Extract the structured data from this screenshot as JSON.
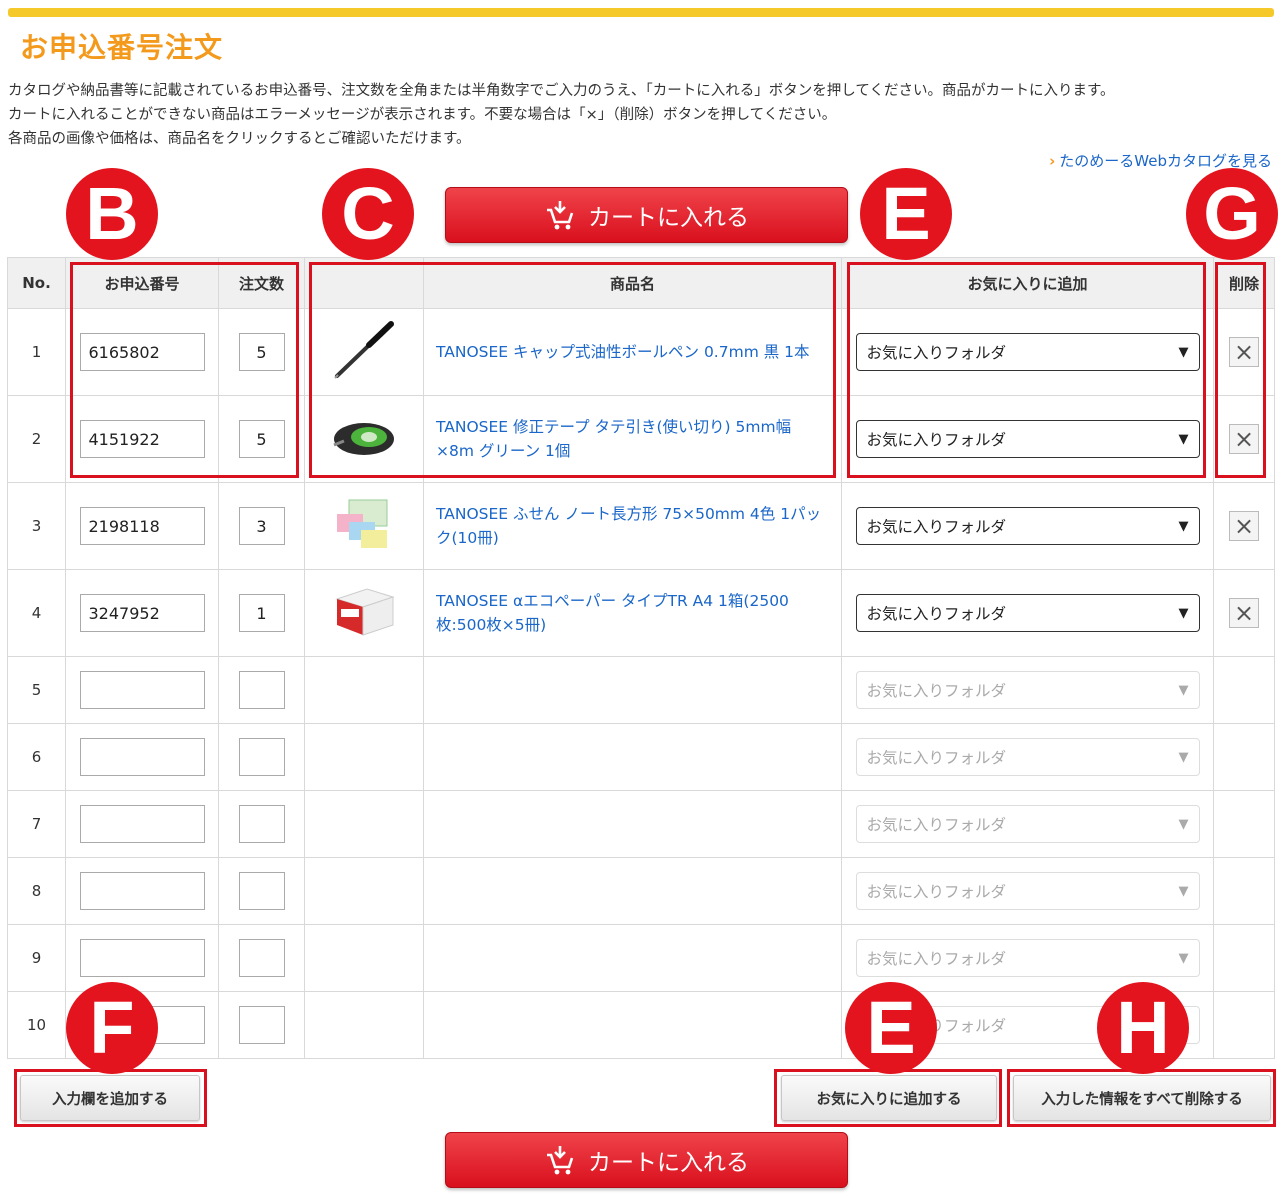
{
  "page": {
    "title": "お申込番号注文",
    "intro_lines": [
      "カタログや納品書等に記載されているお申込番号、注文数を全角または半角数字でご入力のうえ、「カートに入れる」ボタンを押してください。商品がカートに入ります。",
      "カートに入れることができない商品はエラーメッセージが表示されます。不要な場合は「×」（削除）ボタンを押してください。",
      "各商品の画像や価格は、商品名をクリックするとご確認いただけます。"
    ],
    "catalog_link": "たのめーるWebカタログを見る"
  },
  "cart_button_label": "カートに入れる",
  "table": {
    "headers": {
      "no": "No.",
      "code": "お申込番号",
      "qty": "注文数",
      "image": "",
      "name": "商品名",
      "favorite": "お気に入りに追加",
      "delete": "削除"
    },
    "rows": [
      {
        "no": "1",
        "code": "6165802",
        "qty": "5",
        "name": "TANOSEE キャップ式油性ボールペン 0.7mm 黒 1本",
        "favorite": "お気に入りフォルダ"
      },
      {
        "no": "2",
        "code": "4151922",
        "qty": "5",
        "name": "TANOSEE 修正テープ タテ引き(使い切り) 5mm幅×8m グリーン 1個",
        "favorite": "お気に入りフォルダ"
      },
      {
        "no": "3",
        "code": "2198118",
        "qty": "3",
        "name": "TANOSEE ふせん ノート長方形 75×50mm 4色 1パック(10冊)",
        "favorite": "お気に入りフォルダ"
      },
      {
        "no": "4",
        "code": "3247952",
        "qty": "1",
        "name": "TANOSEE αエコペーパー タイプTR A4 1箱(2500枚:500枚×5冊)",
        "favorite": "お気に入りフォルダ"
      },
      {
        "no": "5",
        "code": "",
        "qty": "",
        "name": "",
        "favorite": "お気に入りフォルダ"
      },
      {
        "no": "6",
        "code": "",
        "qty": "",
        "name": "",
        "favorite": "お気に入りフォルダ"
      },
      {
        "no": "7",
        "code": "",
        "qty": "",
        "name": "",
        "favorite": "お気に入りフォルダ"
      },
      {
        "no": "8",
        "code": "",
        "qty": "",
        "name": "",
        "favorite": "お気に入りフォルダ"
      },
      {
        "no": "9",
        "code": "",
        "qty": "",
        "name": "",
        "favorite": "お気に入りフォルダ"
      },
      {
        "no": "10",
        "code": "",
        "qty": "",
        "name": "",
        "favorite": "お気に入りフォルダ"
      }
    ]
  },
  "buttons": {
    "add_rows": "入力欄を追加する",
    "add_favorites": "お気に入りに追加する",
    "clear_all": "入力した情報をすべて削除する"
  },
  "markers": {
    "B": "B",
    "C": "C",
    "E_top": "E",
    "G": "G",
    "F": "F",
    "E_bottom": "E",
    "H": "H"
  },
  "colors": {
    "accent_yellow": "#f6c92b",
    "title_orange": "#f39a1d",
    "cart_red": "#d9101e",
    "link_blue": "#1a66c9",
    "marker_red": "#e3141e"
  },
  "icons": {
    "cart": "cart-download-icon",
    "delete": "close-icon",
    "select": "chevron-down-icon",
    "link": "chevron-right-icon"
  }
}
